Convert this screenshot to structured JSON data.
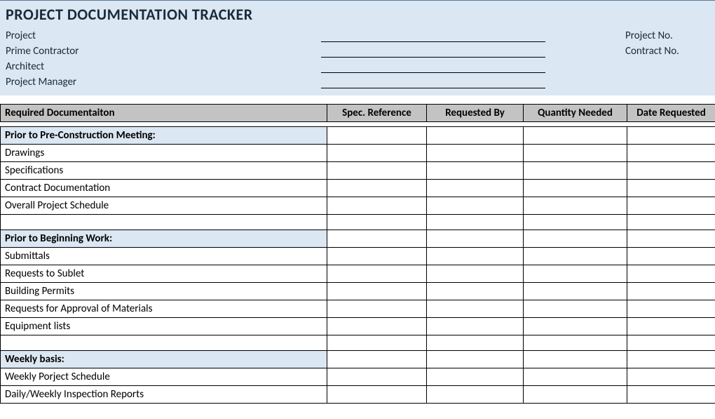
{
  "header": {
    "title": "PROJECT DOCUMENTATION TRACKER",
    "left_labels": {
      "project": "Project",
      "prime_contractor": "Prime Contractor",
      "architect": "Architect",
      "project_manager": "Project Manager"
    },
    "right_labels": {
      "project_no": "Project No.",
      "contract_no": "Contract No."
    }
  },
  "columns": {
    "doc": "Required Documentaiton",
    "spec": "Spec. Reference",
    "req_by": "Requested By",
    "qty": "Quantity Needed",
    "date": "Date Requested"
  },
  "sections": [
    {
      "heading": "Prior to Pre-Construction Meeting:",
      "items": [
        "Drawings",
        "Specifications",
        "Contract Documentation",
        "Overall Project Schedule"
      ]
    },
    {
      "heading": "Prior to Beginning Work:",
      "items": [
        "Submittals",
        "Requests to Sublet",
        "Building Permits",
        "Requests for Approval of Materials",
        "Equipment lists"
      ]
    },
    {
      "heading": "Weekly basis:",
      "items": [
        "Weekly Porject Schedule",
        "Daily/Weekly Inspection Reports"
      ]
    }
  ]
}
